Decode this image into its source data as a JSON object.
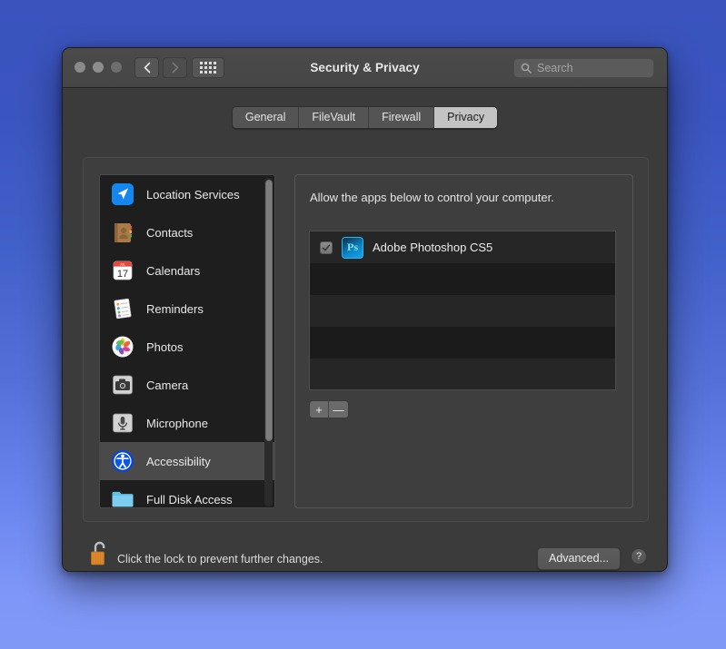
{
  "window": {
    "title": "Security & Privacy",
    "traffic_lights": [
      "close",
      "minimize",
      "maximize"
    ],
    "nav": {
      "back": "back-arrow",
      "forward": "forward-arrow",
      "grid": "show-all-grid"
    },
    "search": {
      "placeholder": "Search",
      "value": "",
      "icon": "search-icon"
    }
  },
  "tabs": [
    {
      "label": "General",
      "active": false
    },
    {
      "label": "FileVault",
      "active": false
    },
    {
      "label": "Firewall",
      "active": false
    },
    {
      "label": "Privacy",
      "active": true
    }
  ],
  "sidebar": {
    "items": [
      {
        "label": "Location Services",
        "icon": "location-services-icon",
        "selected": false
      },
      {
        "label": "Contacts",
        "icon": "contacts-icon",
        "selected": false
      },
      {
        "label": "Calendars",
        "icon": "calendars-icon",
        "selected": false
      },
      {
        "label": "Reminders",
        "icon": "reminders-icon",
        "selected": false
      },
      {
        "label": "Photos",
        "icon": "photos-icon",
        "selected": false
      },
      {
        "label": "Camera",
        "icon": "camera-icon",
        "selected": false
      },
      {
        "label": "Microphone",
        "icon": "microphone-icon",
        "selected": false
      },
      {
        "label": "Accessibility",
        "icon": "accessibility-icon",
        "selected": true
      },
      {
        "label": "Full Disk Access",
        "icon": "folder-icon",
        "selected": false
      }
    ],
    "calendar_icon_day": "17",
    "calendar_icon_month": "JUL"
  },
  "detail": {
    "description": "Allow the apps below to control your computer.",
    "apps": [
      {
        "name": "Adobe Photoshop CS5",
        "checked": true,
        "icon": "photoshop-icon",
        "badge": "Ps"
      }
    ],
    "empty_rows": 4,
    "add_label": "+",
    "remove_label": "—"
  },
  "footer": {
    "lock_icon": "unlocked-padlock-icon",
    "lock_message": "Click the lock to prevent further changes.",
    "advanced_label": "Advanced...",
    "help_label": "?"
  },
  "colors": {
    "desktop_top": "#3a53bd",
    "desktop_bottom": "#8099f7",
    "window_bg": "#3b3b3b",
    "active_tab_bg": "#c3c3c3",
    "selected_row_bg": "#4a4a4a",
    "list_bg": "#242424",
    "lock_body": "#e08a2e",
    "photoshop_blue": "#18a5e8"
  }
}
